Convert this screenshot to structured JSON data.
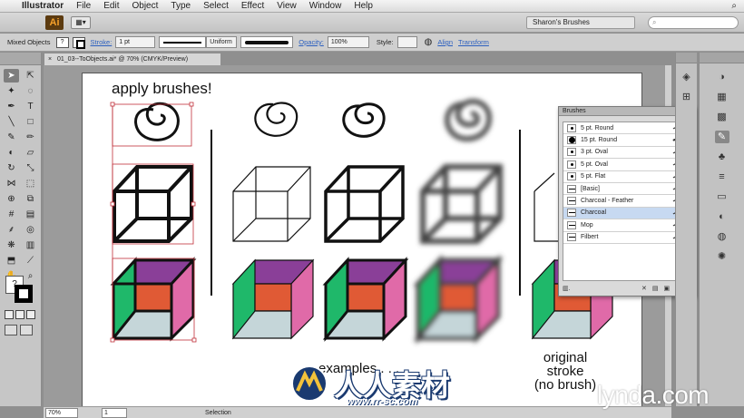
{
  "menubar": {
    "app": "Illustrator",
    "items": [
      "File",
      "Edit",
      "Object",
      "Type",
      "Select",
      "Effect",
      "View",
      "Window",
      "Help"
    ]
  },
  "appbar": {
    "logo": "Ai",
    "workspace": "Sharon's Brushes"
  },
  "control": {
    "selection": "Mixed Objects",
    "stroke_label": "Stroke:",
    "stroke_weight": "1 pt",
    "profile": "Uniform",
    "opacity_label": "Opacity:",
    "opacity": "100%",
    "style_label": "Style:",
    "align": "Align",
    "transform": "Transform"
  },
  "document": {
    "tab": "01_03--ToObjects.ai* @ 70% (CMYK/Preview)",
    "heading": "apply brushes!",
    "examples_label": "examples . . .",
    "original_line1": "original",
    "original_line2": "stroke",
    "original_line3": "(no brush)"
  },
  "status": {
    "zoom": "70%",
    "page": "1",
    "tool": "Selection"
  },
  "brushes": {
    "title": "Brushes",
    "selected_index": 7,
    "items": [
      {
        "name": "5 pt. Round",
        "kind": "dot-small"
      },
      {
        "name": "15 pt. Round",
        "kind": "dot-large"
      },
      {
        "name": "3 pt. Oval",
        "kind": "dot-small"
      },
      {
        "name": "5 pt. Oval",
        "kind": "dot-small"
      },
      {
        "name": "5 pt. Flat",
        "kind": "dot-small"
      },
      {
        "name": "[Basic]",
        "kind": "line"
      },
      {
        "name": "Charcoal - Feather",
        "kind": "line"
      },
      {
        "name": "Charcoal",
        "kind": "line"
      },
      {
        "name": "Mop",
        "kind": "line"
      },
      {
        "name": "Filbert",
        "kind": "line"
      }
    ]
  },
  "colors": {
    "purple": "#8a3f98",
    "pink": "#e06aa8",
    "green": "#1fb86a",
    "orange": "#e05a35",
    "grey": "#c5d6d9",
    "selection": "#c0303a",
    "selected_row": "#c7d9f1"
  },
  "watermark": {
    "brand": "lynda.com",
    "cn_text": "人人素材",
    "cn_url": "www.rr-sc.com"
  }
}
